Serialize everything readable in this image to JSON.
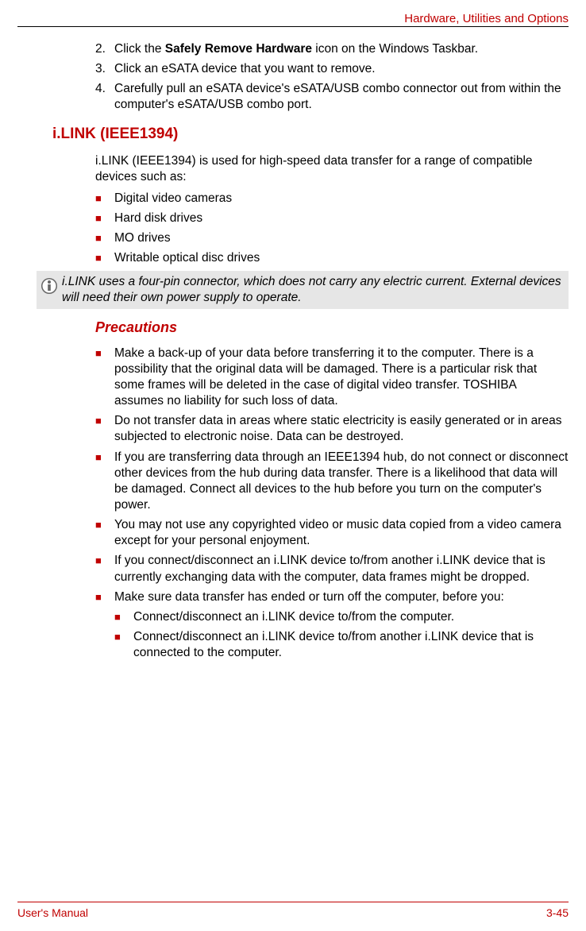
{
  "header": {
    "title": "Hardware, Utilities and Options"
  },
  "steps": {
    "s2": {
      "num": "2.",
      "pre": "Click the ",
      "bold": "Safely Remove Hardware",
      "post": " icon on the Windows Taskbar."
    },
    "s3": {
      "num": "3.",
      "text": "Click an eSATA device that you want to remove."
    },
    "s4": {
      "num": "4.",
      "text": "Carefully pull an eSATA device's eSATA/USB combo connector out from within the computer's eSATA/USB combo port."
    }
  },
  "section": {
    "heading": "i.LINK (IEEE1394)",
    "intro": "i.LINK (IEEE1394) is used for high-speed data transfer for a range of compatible devices such as:",
    "bullets": {
      "b1": "Digital video cameras",
      "b2": "Hard disk drives",
      "b3": "MO drives",
      "b4": "Writable optical disc drives"
    }
  },
  "note": {
    "text": "i.LINK uses a four-pin connector, which does not carry any electric current. External devices will need their own power supply to operate."
  },
  "precautions": {
    "heading": "Precautions",
    "bullets": {
      "p1": "Make a back-up of your data before transferring it to the computer. There is a possibility that the original data will be damaged. There is a particular risk that some frames will be deleted in the case of digital video transfer. TOSHIBA assumes no liability for such loss of data.",
      "p2": "Do not transfer data in areas where static electricity is easily generated or in areas subjected to electronic noise. Data can be destroyed.",
      "p3": "If you are transferring data through an IEEE1394 hub, do not connect or disconnect other devices from the hub during data transfer. There is a likelihood that data will be damaged. Connect all devices to the hub before you turn on the computer's power.",
      "p4": "You may not use any copyrighted video or music data copied from a video camera except for your personal enjoyment.",
      "p5": "If you connect/disconnect an i.LINK device to/from another i.LINK device that is currently exchanging data with the computer, data frames might be dropped.",
      "p6": "Make sure data transfer has ended or turn off the computer, before you:",
      "p6a": "Connect/disconnect an i.LINK device to/from the computer.",
      "p6b": "Connect/disconnect an i.LINK device to/from another i.LINK device that is connected to the computer."
    }
  },
  "footer": {
    "left": "User's Manual",
    "right": "3-45"
  }
}
